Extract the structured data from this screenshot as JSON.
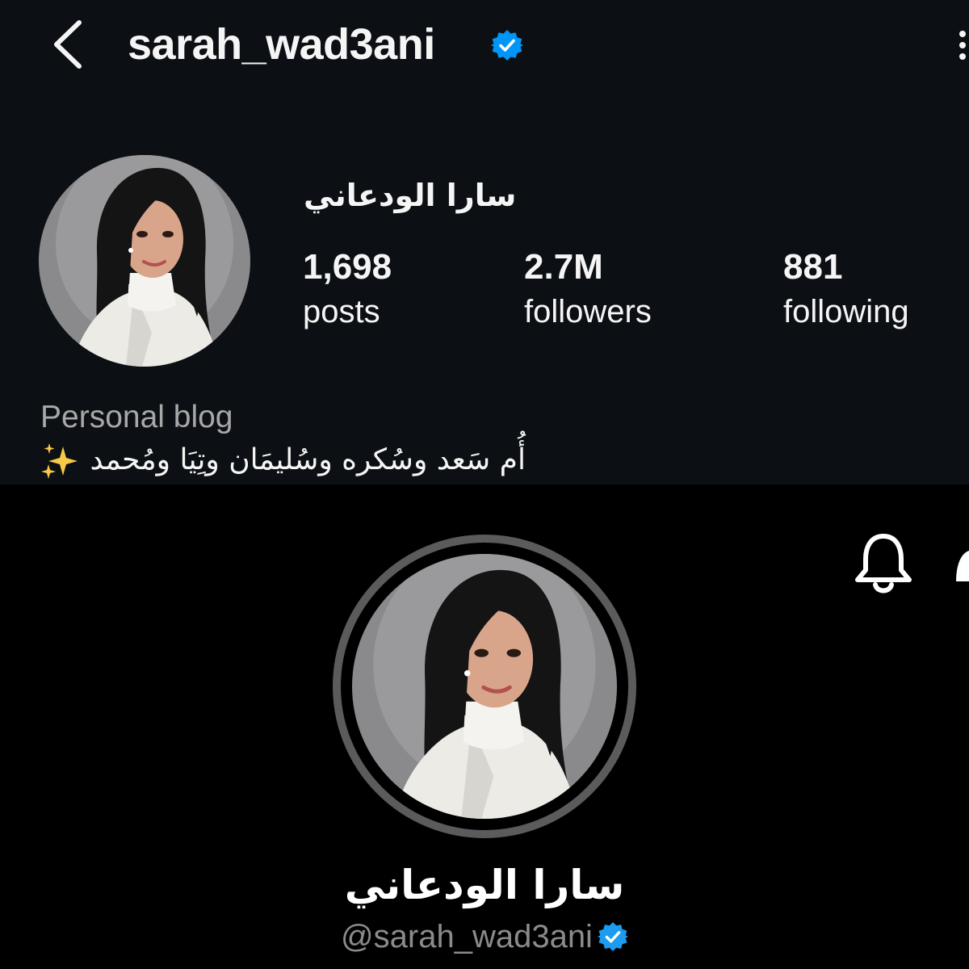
{
  "top_profile": {
    "username": "sarah_wad3ani",
    "display_name": "سارا الودعاني",
    "stats": {
      "posts": {
        "value": "1,698",
        "label": "posts"
      },
      "followers": {
        "value": "2.7M",
        "label": "followers"
      },
      "following": {
        "value": "881",
        "label": "following"
      }
    },
    "category": "Personal blog",
    "bio": "أُم سَعد وسُكره وسُليمَان وتِيَا ومُحمد",
    "bio_emoji": "sparkles-icon",
    "icons": [
      "back-arrow-icon",
      "verified-badge-icon",
      "more-options-icon"
    ],
    "colors": {
      "background": "#0c1014",
      "text": "#f5f5f5",
      "secondary": "#a8a8a8",
      "verified": "#0095f6"
    }
  },
  "bottom_profile": {
    "display_name": "سارا الودعاني",
    "handle": "@sarah_wad3ani",
    "icons": [
      "bell-icon",
      "verified-badge-icon"
    ],
    "colors": {
      "background": "#000000",
      "handle": "#8b8b8b",
      "ring": "#5b5b5b",
      "verified": "#1d9bf0"
    }
  }
}
